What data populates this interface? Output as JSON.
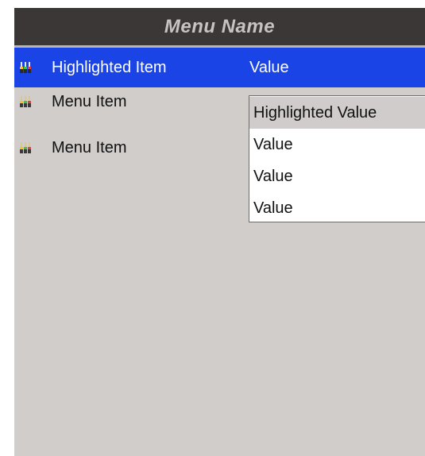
{
  "menu": {
    "title": "Menu Name"
  },
  "items": [
    {
      "label": "Highlighted Item",
      "value": "Value",
      "icon": "probe-icon",
      "highlighted": true
    },
    {
      "label": "Menu Item",
      "icon": "probe-icon",
      "highlighted": false
    },
    {
      "label": "Menu Item",
      "icon": "probe-icon",
      "highlighted": false
    }
  ],
  "dropdown": {
    "options": [
      {
        "label": "Highlighted Value",
        "selected": true
      },
      {
        "label": "Value",
        "selected": false
      },
      {
        "label": "Value",
        "selected": false
      },
      {
        "label": "Value",
        "selected": false
      }
    ]
  },
  "colors": {
    "title_bar": "#3a3736",
    "title_text": "#c6c3c1",
    "background": "#d0cdcb",
    "highlight": "#1a44e6",
    "dropdown_selected": "#cfcccb"
  }
}
